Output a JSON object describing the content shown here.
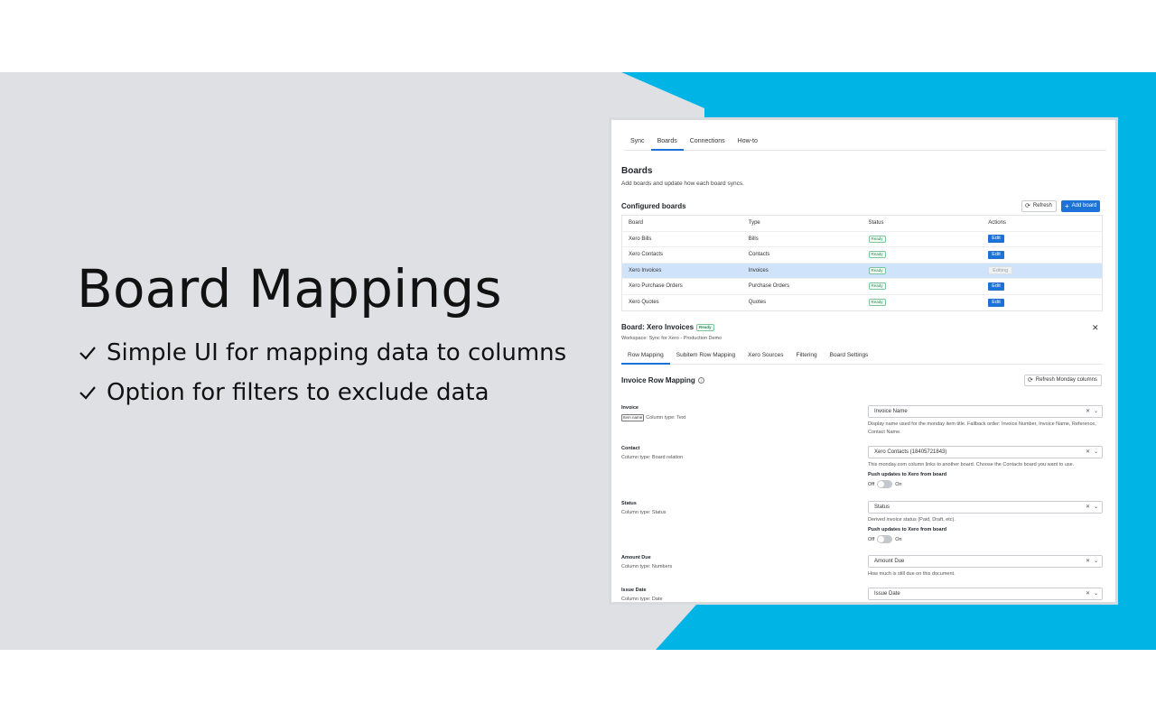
{
  "hero": {
    "title": "Board Mappings",
    "bullets": [
      "Simple UI for mapping data to columns",
      "Option for filters to exclude data"
    ],
    "accent_color": "#00b4e6",
    "background_color": "#dfe0e4"
  },
  "app": {
    "tabs": [
      "Sync",
      "Boards",
      "Connections",
      "How-to"
    ],
    "active_tab": "Boards",
    "page_title": "Boards",
    "page_subtitle": "Add boards and update how each board syncs.",
    "section_title": "Configured boards",
    "refresh_label": "Refresh",
    "add_board_label": "Add board",
    "table": {
      "headers": [
        "Board",
        "Type",
        "Status",
        "Actions"
      ],
      "rows": [
        {
          "board": "Xero Bills",
          "type": "Bills",
          "status": "Ready",
          "action": "Edit"
        },
        {
          "board": "Xero Contacts",
          "type": "Contacts",
          "status": "Ready",
          "action": "Edit"
        },
        {
          "board": "Xero Invoices",
          "type": "Invoices",
          "status": "Ready",
          "action": "Editing"
        },
        {
          "board": "Xero Purchase Orders",
          "type": "Purchase Orders",
          "status": "Ready",
          "action": "Edit"
        },
        {
          "board": "Xero Quotes",
          "type": "Quotes",
          "status": "Ready",
          "action": "Edit"
        }
      ]
    },
    "board_detail": {
      "title": "Board: Xero Invoices",
      "status": "Ready",
      "workspace": "Workspace: Sync for Xero - Production Demo",
      "subtabs": [
        "Row Mapping",
        "Subitem Row Mapping",
        "Xero Sources",
        "Filtering",
        "Board Settings"
      ],
      "active_subtab": "Row Mapping",
      "mapping_title": "Invoice Row Mapping",
      "refresh_columns_label": "Refresh Monday columns",
      "push_label": "Push updates to Xero from board",
      "off_label": "Off",
      "on_label": "On",
      "fields": [
        {
          "label": "Invoice",
          "tag": "Item name",
          "type": "Column type: Text",
          "value": "Invoice Name",
          "help": "Display name used for the monday item title. Fallback order: Invoice Number, Invoice Name, Reference, Contact Name."
        },
        {
          "label": "Contact",
          "type": "Column type: Board relation",
          "value": "Xero Contacts (18405721843)",
          "help": "This monday.com column links to another board. Choose the Contacts board you want to use."
        },
        {
          "label": "Status",
          "type": "Column type: Status",
          "value": "Status",
          "help": "Derived invoice status (Paid, Draft, etc)."
        },
        {
          "label": "Amount Due",
          "type": "Column type: Numbers",
          "value": "Amount Due",
          "help": "How much is still due on this document."
        },
        {
          "label": "Issue Date",
          "type": "Column type: Date",
          "value": "Issue Date",
          "help": ""
        }
      ]
    }
  }
}
